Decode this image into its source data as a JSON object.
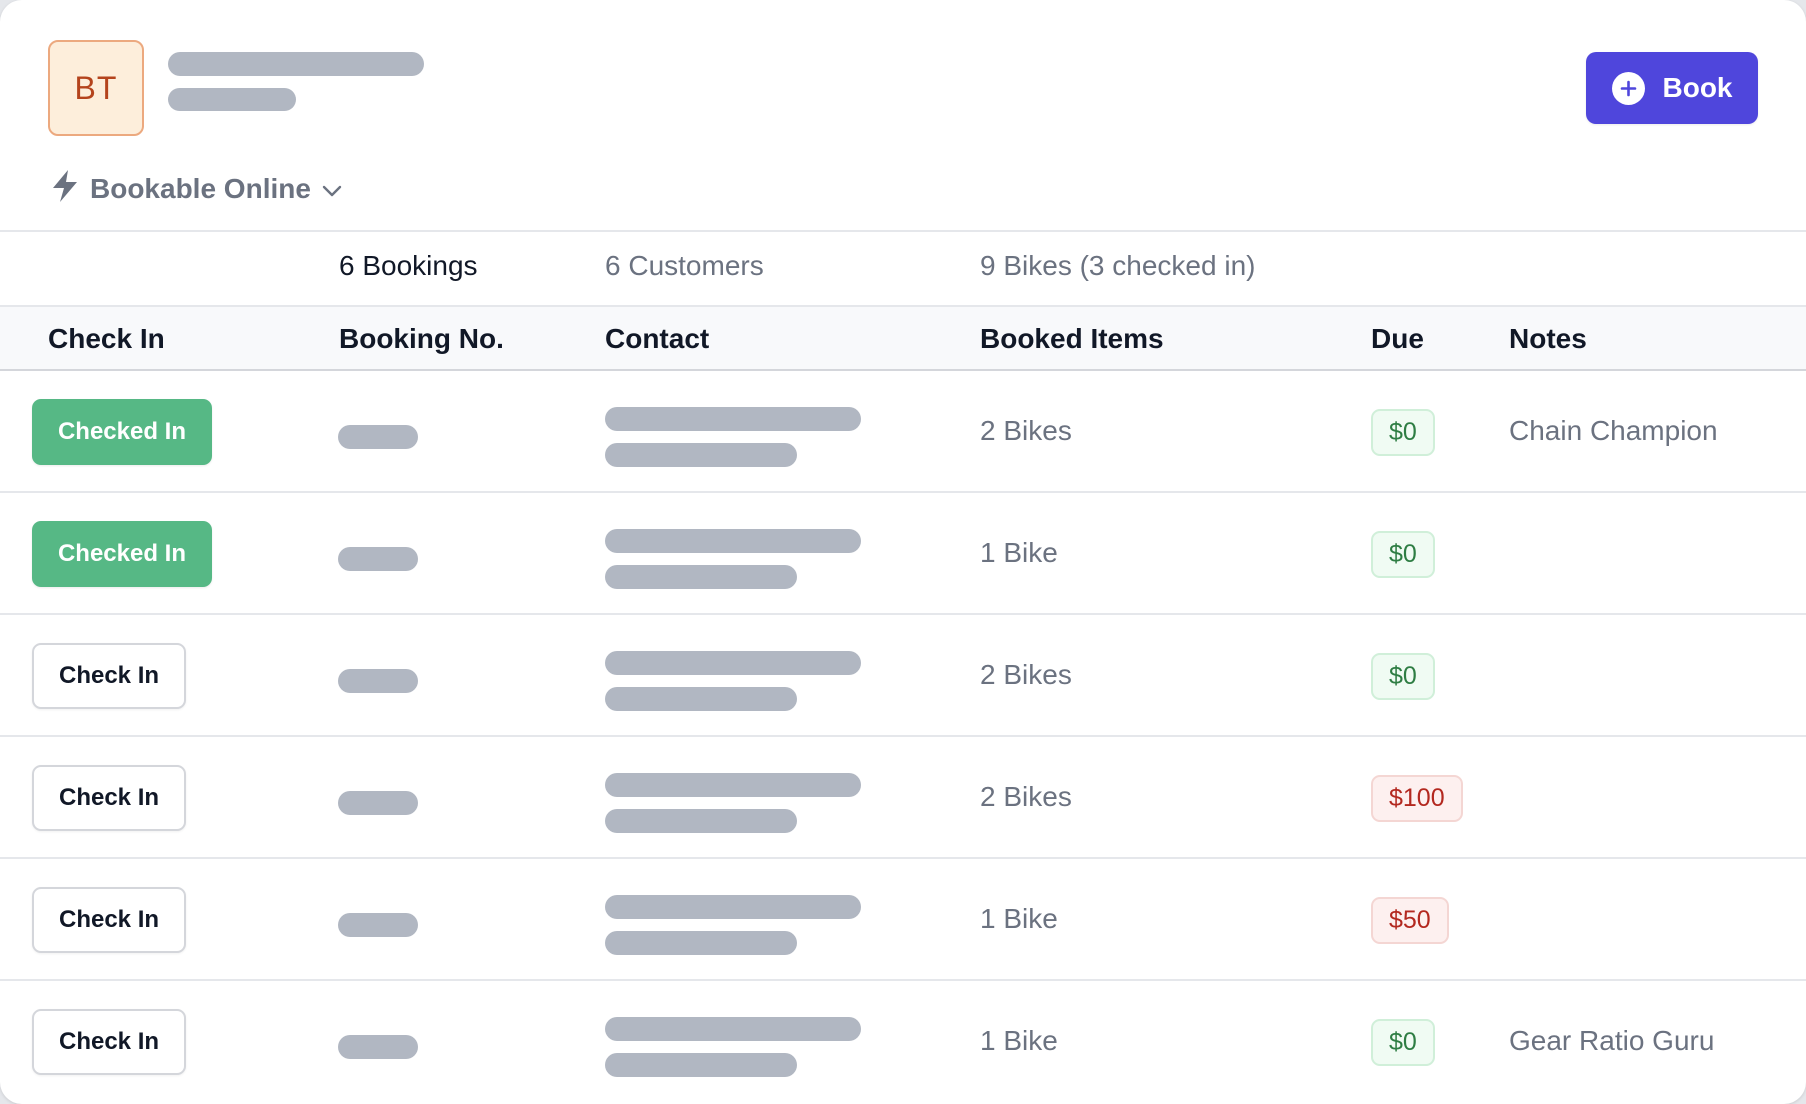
{
  "header": {
    "avatar_initials": "BT",
    "title_placeholder": "redacted-title",
    "subtitle_placeholder": "redacted-subtitle",
    "book_button": {
      "label": "Book",
      "icon": "plus-circle-icon"
    },
    "availability": {
      "icon": "lightning-icon",
      "label": "Bookable Online",
      "dropdown_icon": "chevron-down-icon"
    }
  },
  "summary": {
    "bookings": "6 Bookings",
    "customers": "6 Customers",
    "bikes": "9 Bikes (3 checked in)"
  },
  "table": {
    "columns": [
      "Check In",
      "Booking No.",
      "Contact",
      "Booked Items",
      "Due",
      "Notes"
    ],
    "rows": [
      {
        "checkin_label": "Checked In",
        "checked_in": true,
        "items": "2 Bikes",
        "due": "$0",
        "due_status": "paid",
        "notes": "Chain Champion"
      },
      {
        "checkin_label": "Checked In",
        "checked_in": true,
        "items": "1 Bike",
        "due": "$0",
        "due_status": "paid",
        "notes": ""
      },
      {
        "checkin_label": "Check In",
        "checked_in": false,
        "items": "2 Bikes",
        "due": "$0",
        "due_status": "paid",
        "notes": ""
      },
      {
        "checkin_label": "Check In",
        "checked_in": false,
        "items": "2 Bikes",
        "due": "$100",
        "due_status": "owed",
        "notes": ""
      },
      {
        "checkin_label": "Check In",
        "checked_in": false,
        "items": "1 Bike",
        "due": "$50",
        "due_status": "owed",
        "notes": ""
      },
      {
        "checkin_label": "Check In",
        "checked_in": false,
        "items": "1 Bike",
        "due": "$0",
        "due_status": "paid",
        "notes": "Gear Ratio Guru"
      }
    ]
  },
  "colors": {
    "primary": "#4f46dc",
    "checked_in": "#56b885",
    "due_paid": "#2e7d43",
    "due_owed": "#b3281f",
    "placeholder": "#b1b7c2"
  }
}
